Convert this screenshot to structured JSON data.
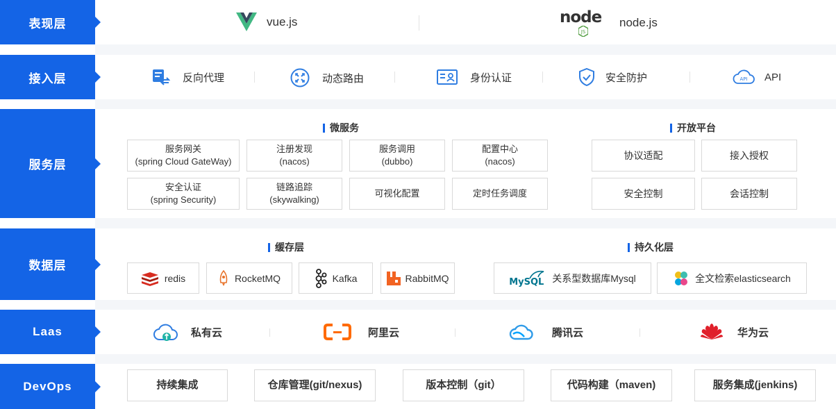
{
  "layers": {
    "presentation": "表现层",
    "access": "接入层",
    "service": "服务层",
    "data": "数据层",
    "laas": "Laas",
    "devops": "DevOps"
  },
  "presentation": {
    "vue": "vue.js",
    "node": "node.js",
    "node_logo": "node"
  },
  "access": {
    "items": [
      "反向代理",
      "动态路由",
      "身份认证",
      "安全防护",
      "API"
    ]
  },
  "service": {
    "micro_title": "微服务",
    "open_title": "开放平台",
    "micro": [
      [
        "服务网关",
        "(spring Cloud GateWay)"
      ],
      [
        "注册发现",
        "(nacos)"
      ],
      [
        "服务调用",
        "(dubbo)"
      ],
      [
        "配置中心",
        "(nacos)"
      ],
      [
        "安全认证",
        "(spring Security)"
      ],
      [
        "链路追踪",
        "(skywalking)"
      ],
      [
        "可视化配置",
        ""
      ],
      [
        "定时任务调度",
        ""
      ]
    ],
    "open": [
      "协议适配",
      "接入授权",
      "安全控制",
      "会话控制"
    ]
  },
  "data": {
    "cache_title": "缓存层",
    "persist_title": "持久化层",
    "cache": [
      "redis",
      "RocketMQ",
      "Kafka",
      "RabbitMQ"
    ],
    "persist": [
      "关系型数据库Mysql",
      "全文检索elasticsearch"
    ],
    "mysql_logo": "MySQL"
  },
  "laas": {
    "items": [
      "私有云",
      "阿里云",
      "腾讯云",
      "华为云"
    ]
  },
  "devops": {
    "items": [
      "持续集成",
      "仓库管理(git/nexus)",
      "版本控制（git）",
      "代码构建（maven)",
      "服务集成(jenkins)"
    ]
  },
  "colors": {
    "brand_blue": "#1464e6",
    "vue_green": "#41b883",
    "vue_dark": "#35495e",
    "node_green": "#539e43",
    "redis_red": "#d82c20",
    "aliyun_orange": "#ff6a00",
    "huawei_red": "#e0202b",
    "icon_blue": "#2f7de1"
  }
}
